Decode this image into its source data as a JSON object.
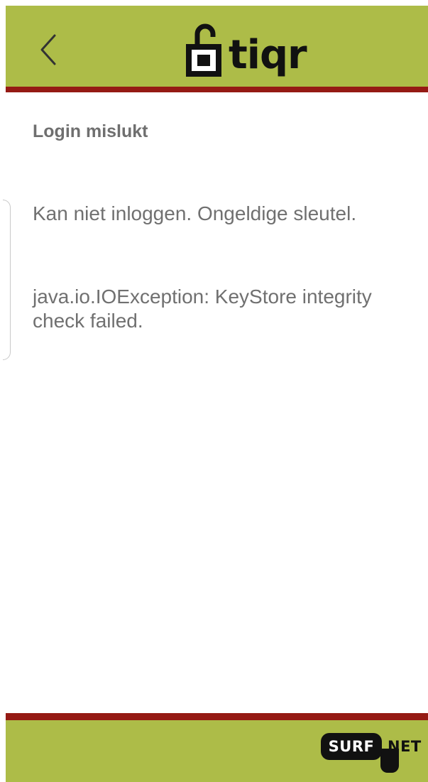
{
  "header": {
    "logo_text": "tiqr",
    "background_color": "#adbc48",
    "accent_bar_color": "#951a14",
    "back_icon": "chevron-left-icon",
    "logo_icon": "open-padlock-icon"
  },
  "content": {
    "title": "Login mislukt",
    "message": "Kan niet inloggen. Ongeldige sleutel.",
    "error_detail": "java.io.IOException: KeyStore integrity check failed."
  },
  "footer": {
    "brand_surf": "SURF",
    "brand_net": "NET"
  }
}
